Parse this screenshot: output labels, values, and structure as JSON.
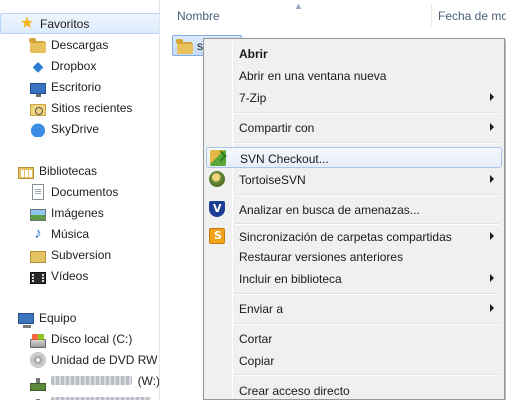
{
  "navigation": {
    "favorites": {
      "header": "Favoritos",
      "items": [
        {
          "label": "Descargas",
          "icon": "downloads-folder-icon"
        },
        {
          "label": "Dropbox",
          "icon": "dropbox-icon"
        },
        {
          "label": "Escritorio",
          "icon": "desktop-icon"
        },
        {
          "label": "Sitios recientes",
          "icon": "recent-places-icon"
        },
        {
          "label": "SkyDrive",
          "icon": "skydrive-icon"
        }
      ]
    },
    "libraries": {
      "header": "Bibliotecas",
      "items": [
        {
          "label": "Documentos",
          "icon": "documents-icon"
        },
        {
          "label": "Imágenes",
          "icon": "pictures-icon"
        },
        {
          "label": "Música",
          "icon": "music-icon"
        },
        {
          "label": "Subversion",
          "icon": "folder-icon"
        },
        {
          "label": "Vídeos",
          "icon": "videos-icon"
        }
      ]
    },
    "computer": {
      "header": "Equipo",
      "items": [
        {
          "label": "Disco local (C:)",
          "icon": "local-disk-icon"
        },
        {
          "label": "Unidad de DVD RW (",
          "icon": "dvd-drive-icon"
        },
        {
          "label": "(W:)",
          "icon": "network-drive-icon",
          "obscured": true
        },
        {
          "label": "",
          "icon": "network-drive-icon",
          "obscured": true
        }
      ]
    }
  },
  "file_list": {
    "columns": {
      "name": "Nombre",
      "date": "Fecha de mo"
    },
    "selected_item": {
      "label": "s",
      "icon": "folder-icon"
    }
  },
  "context_menu": {
    "items": [
      {
        "label": "Abrir",
        "bold": true
      },
      {
        "label": "Abrir en una ventana nueva"
      },
      {
        "label": "7-Zip",
        "submenu": true
      },
      {
        "label": "Compartir con",
        "submenu": true
      },
      {
        "label": "SVN Checkout...",
        "icon": "svn-checkout-icon",
        "highlighted": true
      },
      {
        "label": "TortoiseSVN",
        "icon": "tortoisesvn-icon",
        "submenu": true
      },
      {
        "label": "Analizar en busca de amenazas...",
        "icon": "antivirus-shield-icon"
      },
      {
        "label": "Sincronización de carpetas compartidas",
        "icon": "sync-folders-icon",
        "submenu": true
      },
      {
        "label": "Restaurar versiones anteriores"
      },
      {
        "label": "Incluir en biblioteca",
        "submenu": true
      },
      {
        "label": "Enviar a",
        "submenu": true
      },
      {
        "label": "Cortar"
      },
      {
        "label": "Copiar"
      },
      {
        "label": "Crear acceso directo"
      }
    ]
  },
  "colors": {
    "selection": "#dcebfc",
    "menu_background": "#f0f0f0",
    "header_text": "#4c607a"
  }
}
